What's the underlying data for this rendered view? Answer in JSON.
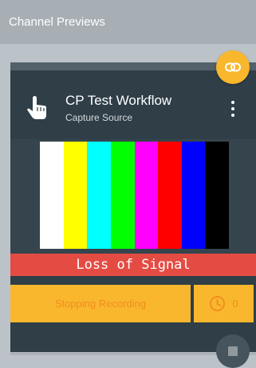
{
  "header": {
    "title": "Channel Previews"
  },
  "card": {
    "title": "CP Test Workflow",
    "subtitle": "Capture Source",
    "icons": {
      "link": "link-icon",
      "source": "touch-icon",
      "menu": "more-vertical-icon"
    }
  },
  "preview": {
    "color_bars": [
      "#ffffff",
      "#ffff00",
      "#00ffff",
      "#00ff00",
      "#ff00ff",
      "#ff0000",
      "#0000ff",
      "#000000"
    ],
    "status_text": "Loss of Signal",
    "status_color": "#e44c43"
  },
  "actions": {
    "stop_label": "Stopping Recording",
    "timer_value": "0",
    "timer_icon": "clock-icon",
    "stop_icon": "stop-icon"
  },
  "colors": {
    "accent": "#f9b72d",
    "accent_text": "#f28d1e",
    "card_bg": "#2f3e47",
    "header_bg": "#a7afb5"
  }
}
